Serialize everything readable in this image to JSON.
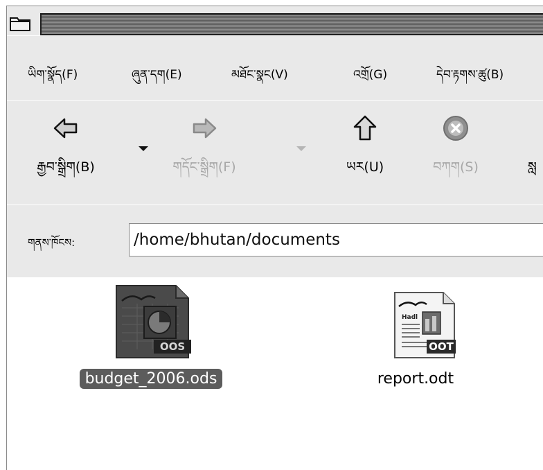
{
  "window": {
    "title": ""
  },
  "menubar": {
    "items": [
      {
        "label": "ཡིག་སྣོད(F)"
      },
      {
        "label": "ཞུན་དག(E)"
      },
      {
        "label": "མཐོང་སྣང(V)"
      },
      {
        "label": "འགྲོ(G)"
      },
      {
        "label": "དེབ་རྟགས་ཚུ(B)"
      }
    ]
  },
  "toolbar": {
    "back": {
      "label": "རྒྱབ་སྒྲིག(B)",
      "icon": "back-arrow-icon"
    },
    "forward": {
      "label": "གདོང་སྒྲིག(F)",
      "icon": "forward-arrow-icon",
      "disabled": true
    },
    "up": {
      "label": "ཡར(U)",
      "icon": "up-arrow-icon"
    },
    "stop": {
      "label": "བཀག(S)",
      "icon": "stop-icon",
      "disabled": true
    },
    "reload": {
      "label": "སླ"
    }
  },
  "location": {
    "label": "གནས་ཁོངས:",
    "value": "/home/bhutan/documents"
  },
  "files": [
    {
      "name": "budget_2006.ods",
      "badge": "OOS",
      "icon": "spreadsheet-file-icon",
      "selected": true
    },
    {
      "name": "report.odt",
      "badge": "OOT",
      "icon": "text-document-file-icon",
      "selected": false
    }
  ],
  "colors": {
    "selection": "#5c5c5c",
    "toolbar_bg": "#e9e9e9"
  }
}
